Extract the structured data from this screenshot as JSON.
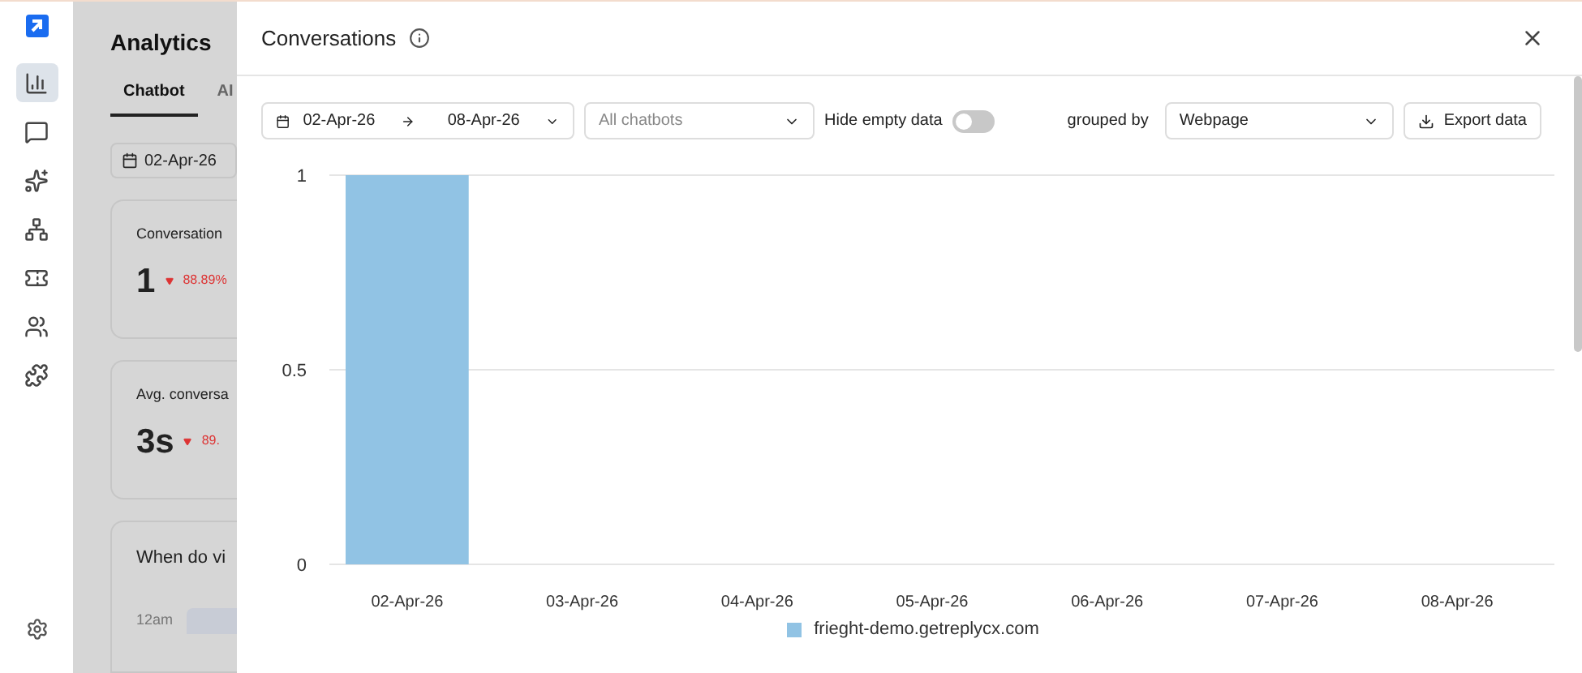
{
  "sidebar": {
    "items": [
      {
        "selected": true
      },
      {
        "selected": false
      },
      {
        "selected": false
      },
      {
        "selected": false
      },
      {
        "selected": false
      },
      {
        "selected": false
      },
      {
        "selected": false
      }
    ]
  },
  "background": {
    "title": "Analytics",
    "tabs": [
      {
        "label": "Chatbot",
        "selected": true
      },
      {
        "label": "AI",
        "selected": false
      }
    ],
    "date": "02-Apr-26",
    "cards": [
      {
        "title": "Conversation",
        "value": "1",
        "change": "88.89%"
      },
      {
        "title": "Avg. conversa",
        "value": "3s",
        "change": "89."
      }
    ],
    "section": {
      "title": "When do vi",
      "row_label": "12am"
    }
  },
  "drawer": {
    "title": "Conversations",
    "date_from": "02-Apr-26",
    "date_to": "08-Apr-26",
    "chatbot_placeholder": "All chatbots",
    "hide_empty": {
      "label": "Hide empty data",
      "on": false
    },
    "grouped_by_label": "grouped by",
    "grouped_by": "Webpage",
    "export": "Export data",
    "chart_data": {
      "type": "bar",
      "categories": [
        "02-Apr-26",
        "03-Apr-26",
        "04-Apr-26",
        "05-Apr-26",
        "06-Apr-26",
        "07-Apr-26",
        "08-Apr-26"
      ],
      "series": [
        {
          "name": "frieght-demo.getreplycx.com",
          "color": "#91c3e4",
          "values": [
            1,
            0,
            0,
            0,
            0,
            0,
            0
          ]
        }
      ],
      "ylim": [
        0,
        1
      ],
      "yticks": [
        0,
        0.5,
        1
      ]
    }
  }
}
